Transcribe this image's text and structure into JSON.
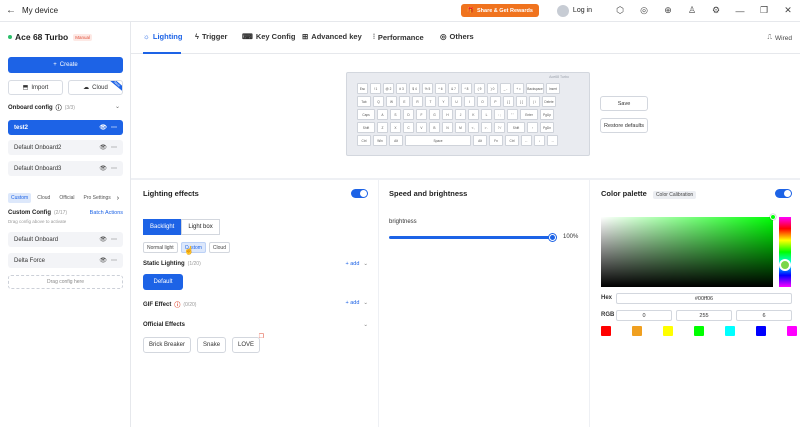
{
  "titlebar": {
    "title": "My device",
    "share_label": "Share & Get Rewards",
    "login_label": "Log in"
  },
  "sidebar": {
    "device_name": "Ace 68 Turbo",
    "device_badge": "Manual",
    "create_label": "Create",
    "import_label": "Import",
    "cloud_label": "Cloud",
    "new_ribbon": "New",
    "onboard_title": "Onboard config",
    "onboard_count": "(3/3)",
    "onboard_items": [
      "test2",
      "Default Onboard2",
      "Default Onboard3"
    ],
    "tabs": [
      "Custom",
      "Cloud",
      "Official",
      "Pro Settings"
    ],
    "custom_title": "Custom Config",
    "custom_count": "(2/17)",
    "batch_label": "Batch Actions",
    "drag_hint": "Drag config above to activate",
    "custom_items": [
      "Default Onboard",
      "Delta Force"
    ],
    "drag_box": "Drag config here"
  },
  "tabs": [
    "Lighting",
    "Trigger",
    "Key Config",
    "Advanced key",
    "Performance",
    "Others"
  ],
  "connection": "Wired",
  "keyboard": {
    "brand": "Ace68 Turbo",
    "rows": [
      [
        "Esc",
        "! 1",
        "@ 2",
        "# 3",
        "$ 4",
        "% 5",
        "^ 6",
        "& 7",
        "* 8",
        "( 9",
        ") 0",
        "_ -",
        "+ =",
        "Backspace",
        "Insert"
      ],
      [
        "Tab",
        "Q",
        "W",
        "E",
        "R",
        "T",
        "Y",
        "U",
        "I",
        "O",
        "P",
        "{ [",
        "} ]",
        "| \\",
        "Delete"
      ],
      [
        "Caps",
        "A",
        "S",
        "D",
        "F",
        "G",
        "H",
        "J",
        "K",
        "L",
        ": ;",
        "\" '",
        "Enter",
        "PgUp"
      ],
      [
        "Shift",
        "Z",
        "X",
        "C",
        "V",
        "B",
        "N",
        "M",
        "< ,",
        "> .",
        "? /",
        "Shift",
        "↑",
        "PgDn"
      ],
      [
        "Ctrl",
        "Win",
        "Alt",
        "Space",
        "Alt",
        "Fn",
        "Ctrl",
        "←",
        "↓",
        "→"
      ]
    ]
  },
  "actions": {
    "save": "Save",
    "restore": "Restore defaults"
  },
  "lighting": {
    "title": "Lighting effects",
    "modes": [
      "Backlight",
      "Light box"
    ],
    "submodes": [
      "Normal light",
      "Custom",
      "Cloud"
    ],
    "static_title": "Static Lighting",
    "static_count": "(1/20)",
    "add_label": "+ add",
    "default_btn": "Default",
    "gif_title": "GIF Effect",
    "gif_count": "(0/20)",
    "official_title": "Official Effects",
    "official_items": [
      "Brick Breaker",
      "Snake",
      "LOVE"
    ]
  },
  "speed": {
    "title": "Speed and brightness",
    "brightness_label": "brightness",
    "brightness_value": 100,
    "brightness_text": "100%"
  },
  "palette": {
    "title": "Color palette",
    "calibration": "Color Calibration",
    "hex_label": "Hex",
    "hex_value": "#00ff06",
    "rgb_label": "RGB",
    "r": "0",
    "g": "255",
    "b": "6",
    "swatches": [
      "#ff0000",
      "#f0a020",
      "#ffff00",
      "#00ff00",
      "#00ffff",
      "#0000ff",
      "#ff00ff"
    ],
    "accent": "#1d63e6"
  }
}
